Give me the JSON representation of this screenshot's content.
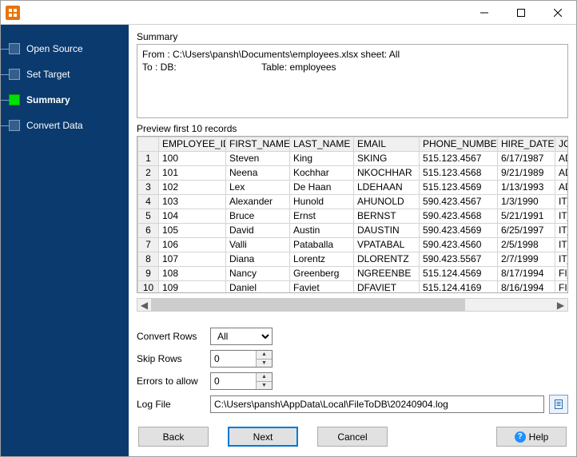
{
  "titlebar": {
    "title": ""
  },
  "sidebar": {
    "steps": [
      {
        "label": "Open Source",
        "active": false
      },
      {
        "label": "Set Target",
        "active": false
      },
      {
        "label": "Summary",
        "active": true
      },
      {
        "label": "Convert Data",
        "active": false
      }
    ]
  },
  "summary": {
    "heading": "Summary",
    "line1": "From : C:\\Users\\pansh\\Documents\\employees.xlsx sheet: All",
    "line2": "To : DB:                                Table: employees"
  },
  "preview": {
    "heading": "Preview first 10 records",
    "columns": [
      "",
      "EMPLOYEE_ID",
      "FIRST_NAME",
      "LAST_NAME",
      "EMAIL",
      "PHONE_NUMBER",
      "HIRE_DATE",
      "JOB"
    ],
    "rows": [
      [
        "1",
        "100",
        "Steven",
        "King",
        "SKING",
        "515.123.4567",
        "6/17/1987",
        "AD_"
      ],
      [
        "2",
        "101",
        "Neena",
        "Kochhar",
        "NKOCHHAR",
        "515.123.4568",
        "9/21/1989",
        "AD_"
      ],
      [
        "3",
        "102",
        "Lex",
        "De Haan",
        "LDEHAAN",
        "515.123.4569",
        "1/13/1993",
        "AD_"
      ],
      [
        "4",
        "103",
        "Alexander",
        "Hunold",
        "AHUNOLD",
        "590.423.4567",
        "1/3/1990",
        "IT_P"
      ],
      [
        "5",
        "104",
        "Bruce",
        "Ernst",
        "BERNST",
        "590.423.4568",
        "5/21/1991",
        "IT_P"
      ],
      [
        "6",
        "105",
        "David",
        "Austin",
        "DAUSTIN",
        "590.423.4569",
        "6/25/1997",
        "IT_P"
      ],
      [
        "7",
        "106",
        "Valli",
        "Pataballa",
        "VPATABAL",
        "590.423.4560",
        "2/5/1998",
        "IT_P"
      ],
      [
        "8",
        "107",
        "Diana",
        "Lorentz",
        "DLORENTZ",
        "590.423.5567",
        "2/7/1999",
        "IT_P"
      ],
      [
        "9",
        "108",
        "Nancy",
        "Greenberg",
        "NGREENBE",
        "515.124.4569",
        "8/17/1994",
        "FI_M"
      ],
      [
        "10",
        "109",
        "Daniel",
        "Faviet",
        "DFAVIET",
        "515.124.4169",
        "8/16/1994",
        "FI_A"
      ]
    ]
  },
  "form": {
    "convert_rows_label": "Convert Rows",
    "convert_rows_value": "All",
    "skip_rows_label": "Skip Rows",
    "skip_rows_value": "0",
    "errors_label": "Errors to allow",
    "errors_value": "0",
    "logfile_label": "Log File",
    "logfile_value": "C:\\Users\\pansh\\AppData\\Local\\FileToDB\\20240904.log"
  },
  "footer": {
    "back": "Back",
    "next": "Next",
    "cancel": "Cancel",
    "help": "Help"
  }
}
